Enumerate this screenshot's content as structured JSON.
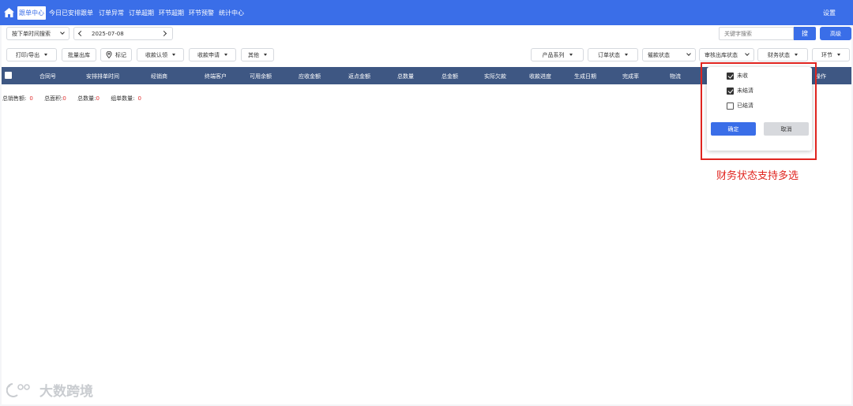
{
  "nav": {
    "items": [
      "跟单中心",
      "今日已安排跟单",
      "订单异常",
      "订单超期",
      "环节超期",
      "环节预警",
      "统计中心"
    ],
    "settings_label": "设置"
  },
  "toolbar1": {
    "time_filter": "按下单时间搜索",
    "date": "2025-07-08",
    "search_placeholder": "关键字搜索",
    "search_label": "搜",
    "advanced_label": "高级"
  },
  "toolbar2": {
    "print_export": "打印/导出",
    "batch_outbound": "批量出库",
    "mark": "标记",
    "payment_claim": "收款认领",
    "payment_apply": "收款申请",
    "other": "其他",
    "product_series": "产品系列",
    "order_status": "订单状态",
    "collection_status": "催款状态",
    "audit_status": "审核出库状态",
    "finance_status": "财务状态",
    "stage": "环节"
  },
  "table": {
    "columns": [
      "合同号",
      "安排排单时间",
      "经销商",
      "终端客户",
      "可用余额",
      "应收金额",
      "返点金额",
      "总数量",
      "总金额",
      "实际欠款",
      "收款进度",
      "生成日期",
      "完成率",
      "物流",
      "操作"
    ]
  },
  "summary": {
    "sales_label": "总销售额:",
    "sales_value": "0",
    "area_label": "总面积:",
    "area_value": "0",
    "qty_label": "总数量:",
    "qty_value": "0",
    "group_label": "组单数量:",
    "group_value": "0"
  },
  "popup": {
    "options": [
      {
        "label": "未收",
        "checked": true
      },
      {
        "label": "未结清",
        "checked": true
      },
      {
        "label": "已结清",
        "checked": false
      }
    ],
    "confirm": "确定",
    "cancel": "取消"
  },
  "annotation": "财务状态支持多选",
  "watermark": "大数跨境",
  "colors": {
    "primary": "#3a6ee8",
    "header": "#3e5783",
    "highlight": "#e0241f"
  }
}
